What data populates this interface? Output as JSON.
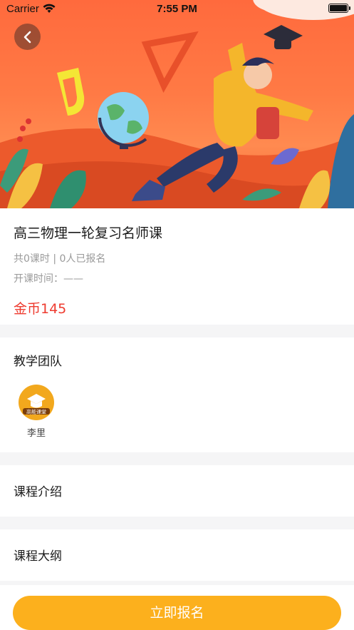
{
  "status_bar": {
    "carrier": "Carrier",
    "time": "7:55 PM"
  },
  "header": {
    "back_icon": "chevron-left-icon"
  },
  "course": {
    "title": "高三物理一轮复习名师课",
    "meta": "共0课时 | 0人已报名",
    "start_time": "开课时间：——",
    "price": "金币145"
  },
  "team": {
    "title": "教学团队",
    "teachers": [
      {
        "name": "李里",
        "badge_text": "高能课堂"
      }
    ]
  },
  "sections": {
    "intro": "课程介绍",
    "outline": "课程大纲"
  },
  "footer": {
    "enroll_label": "立即报名"
  },
  "colors": {
    "accent": "#fcb01d",
    "price": "#ee3b2f",
    "hero": "#ff7a45"
  }
}
